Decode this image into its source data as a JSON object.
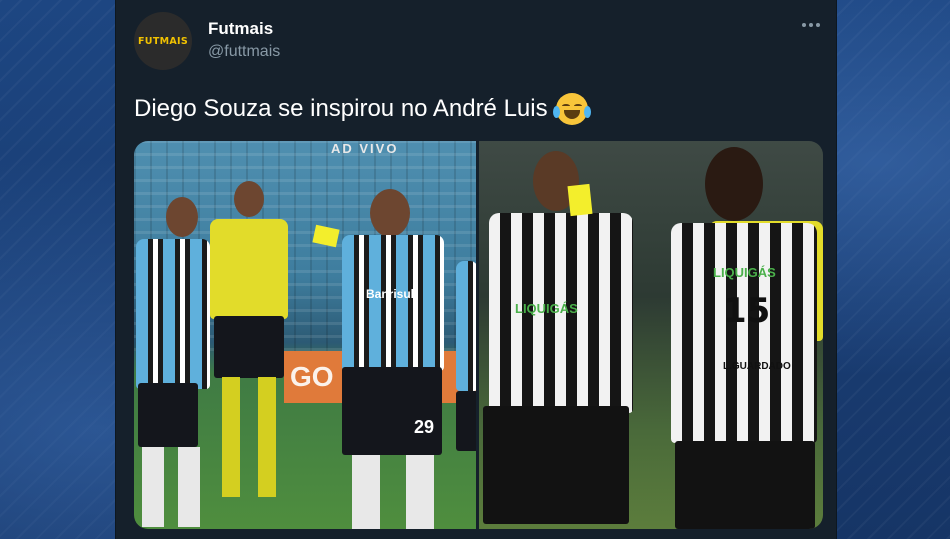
{
  "tweet": {
    "display_name": "Futmais",
    "handle": "@futtmais",
    "avatar_text": "FUTMAIS",
    "text": "Diego Souza se inspirou no André Luis",
    "emoji": "face-with-tears-of-joy"
  },
  "media": {
    "left_photo": {
      "overlay_label": "AD VIVO",
      "ad_board_text": "GO",
      "shirt_sponsor": "Banrisul",
      "shorts_number": "29"
    },
    "right_photo": {
      "shirt_sponsor_left": "LIQUIGÁS",
      "shirt_sponsor_right": "LIQUIGÁS",
      "jersey_number": "15",
      "jersey_name": "L.GUARDADO"
    }
  },
  "colors": {
    "background": "#1b3f78",
    "card": "#15202b",
    "text_primary": "#ffffff",
    "text_secondary": "#8899a6",
    "avatar_accent": "#f2c200",
    "yellow_card": "#f3ee2c"
  }
}
